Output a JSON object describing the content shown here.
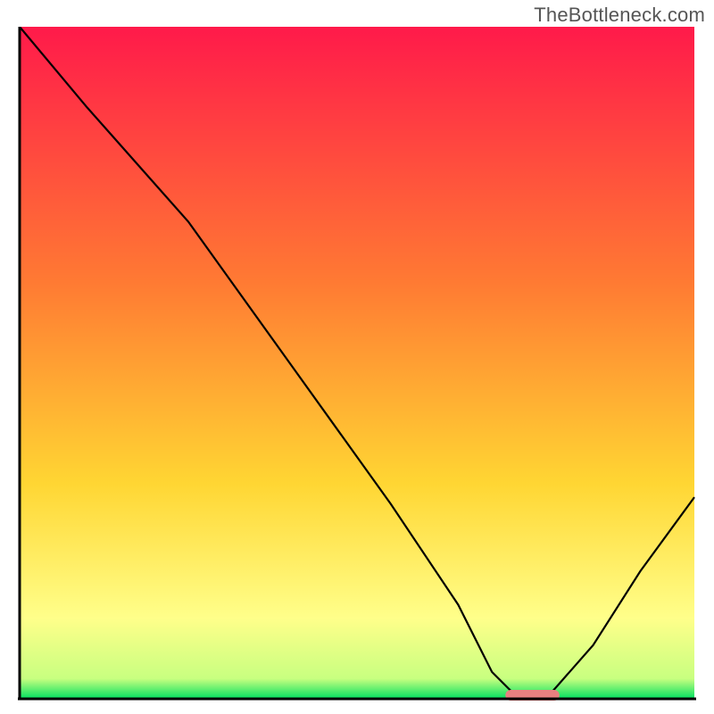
{
  "watermark_text": "TheBottleneck.com",
  "colors": {
    "gradient_top": "#ff1a4a",
    "gradient_mid1": "#ff7a33",
    "gradient_mid2": "#ffd633",
    "gradient_yellowlight": "#ffff8a",
    "gradient_green": "#00e060",
    "curve": "#000000",
    "marker": "#e88080",
    "axis": "#000000"
  },
  "chart_data": {
    "type": "line",
    "title": "",
    "xlabel": "",
    "ylabel": "",
    "xlim": [
      0,
      100
    ],
    "ylim": [
      0,
      100
    ],
    "grid": false,
    "legend": false,
    "series": [
      {
        "name": "bottleneck-curve",
        "x": [
          0,
          10,
          25,
          30,
          40,
          55,
          65,
          70,
          74,
          78,
          85,
          92,
          100
        ],
        "y": [
          100,
          88,
          71,
          64,
          50,
          29,
          14,
          4,
          0,
          0,
          8,
          19,
          30
        ]
      }
    ],
    "marker": {
      "name": "optimal-range",
      "x_start": 72,
      "x_end": 80,
      "y": 0
    }
  }
}
